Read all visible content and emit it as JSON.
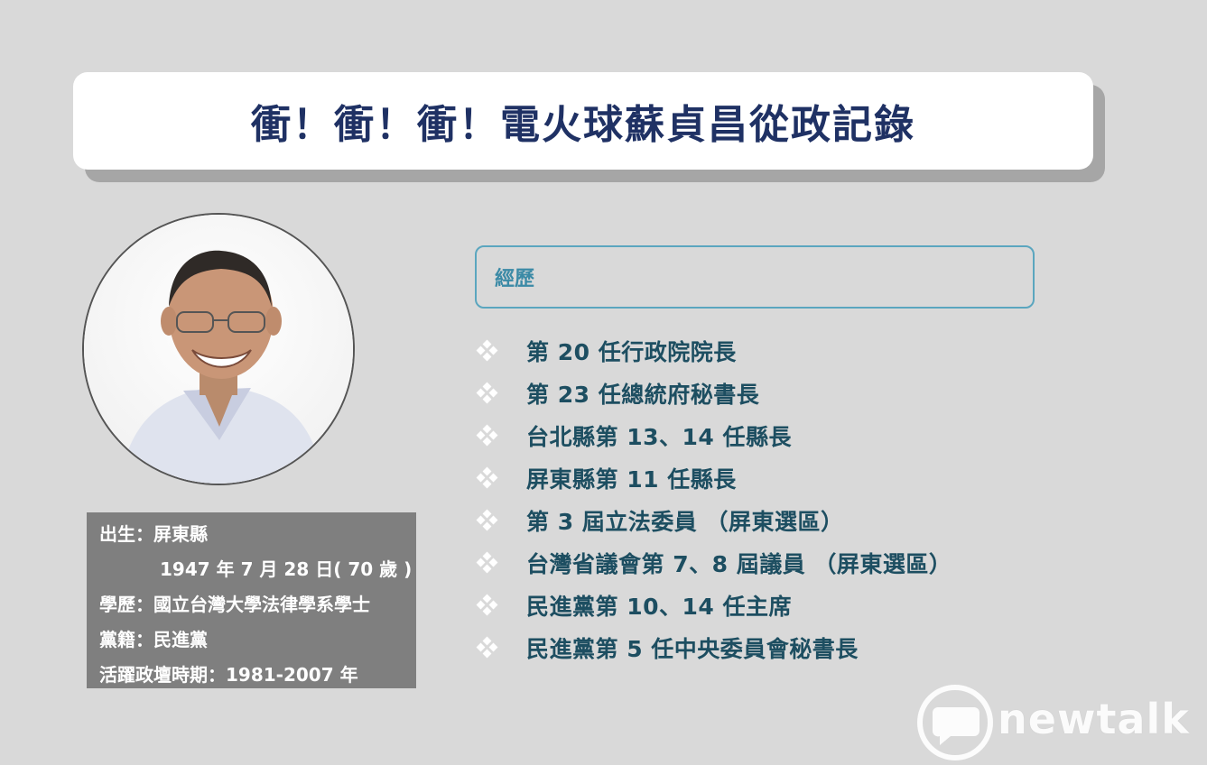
{
  "header": {
    "title": "衝！衝！衝！電火球蘇貞昌從政記錄"
  },
  "profile": {
    "birth_label": "出生：屏東縣",
    "birth_date": "1947 年 7 月 28 日( 70 歲 )",
    "education": "學歷：國立台灣大學法律學系學士",
    "party": "黨籍：民進黨",
    "active_period": "活躍政壇時期：1981-2007 年"
  },
  "experience": {
    "heading": "經歷",
    "items": [
      "第 20 任行政院院長",
      "第 23 任總統府秘書長",
      "台北縣第 13、14 任縣長",
      "屏東縣第 11 任縣長",
      "第 3 屆立法委員 （屏東選區）",
      "台灣省議會第 7、8 屆議員 （屏東選區）",
      "民進黨第 10、14 任主席",
      "民進黨第 5 任中央委員會秘書長"
    ]
  },
  "branding": {
    "logo_text": "newtalk"
  },
  "colors": {
    "title": "#1f3164",
    "accent": "#3b8aa6",
    "item_text": "#1d4e61",
    "info_bg": "#7f7f7f"
  }
}
